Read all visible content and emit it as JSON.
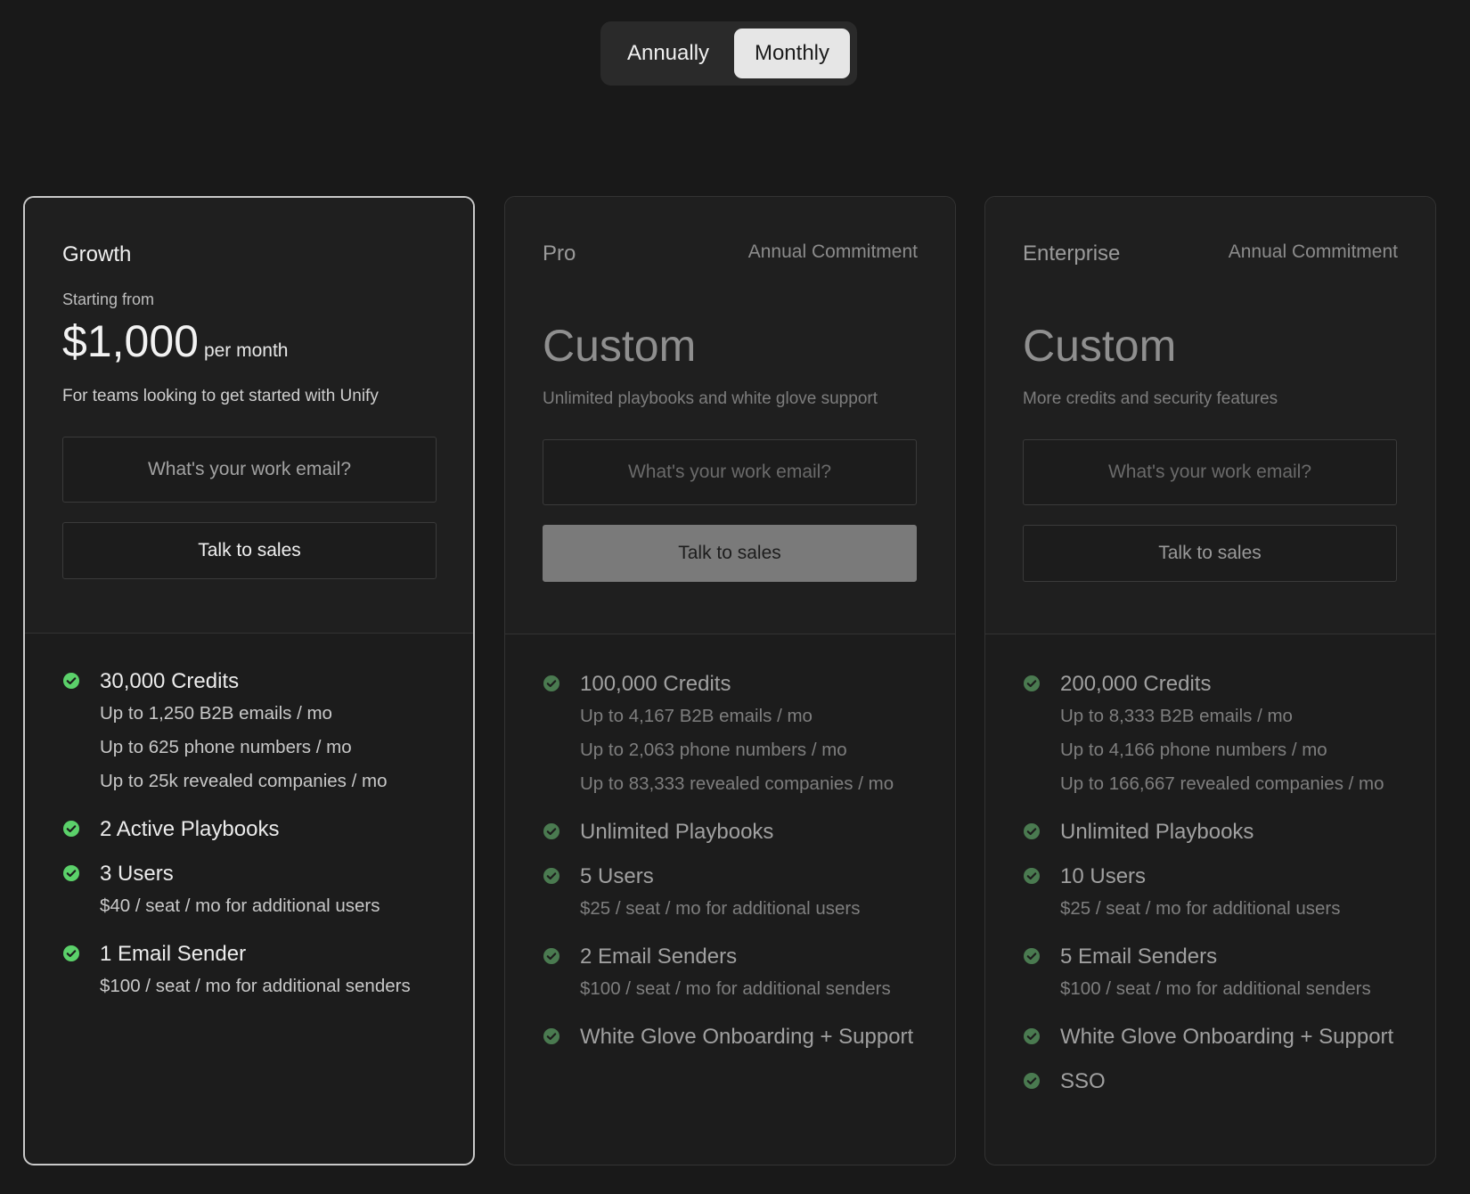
{
  "billing_toggle": {
    "annually_label": "Annually",
    "monthly_label": "Monthly",
    "selected": "Monthly"
  },
  "colors": {
    "check_active": "#5bd16a",
    "check_dim": "#4a7a50"
  },
  "plans": [
    {
      "name": "Growth",
      "starting_from": "Starting from",
      "price": "$1,000",
      "price_unit": "per month",
      "tagline": "For teams looking to get started with Unify",
      "email_placeholder": "What's your work email?",
      "cta_label": "Talk to sales",
      "features": [
        {
          "title": "30,000 Credits",
          "subs": [
            "Up to 1,250 B2B emails / mo",
            "Up to 625 phone numbers / mo",
            "Up to 25k revealed companies / mo"
          ]
        },
        {
          "title": "2 Active Playbooks",
          "subs": []
        },
        {
          "title": "3 Users",
          "subs": [
            "$40 / seat / mo for additional users"
          ]
        },
        {
          "title": "1 Email Sender",
          "subs": [
            "$100 / seat / mo for additional senders"
          ]
        }
      ]
    },
    {
      "name": "Pro",
      "commitment": "Annual Commitment",
      "price": "Custom",
      "tagline": "Unlimited playbooks and white glove support",
      "email_placeholder": "What's your work email?",
      "cta_label": "Talk to sales",
      "features": [
        {
          "title": "100,000 Credits",
          "subs": [
            "Up to 4,167 B2B emails / mo",
            "Up to 2,063 phone numbers / mo",
            "Up to 83,333 revealed companies / mo"
          ]
        },
        {
          "title": "Unlimited Playbooks",
          "subs": []
        },
        {
          "title": "5 Users",
          "subs": [
            "$25 / seat / mo for additional users"
          ]
        },
        {
          "title": "2 Email Senders",
          "subs": [
            "$100 / seat / mo for additional senders"
          ]
        },
        {
          "title": "White Glove Onboarding + Support",
          "subs": []
        }
      ]
    },
    {
      "name": "Enterprise",
      "commitment": "Annual Commitment",
      "price": "Custom",
      "tagline": "More credits and security features",
      "email_placeholder": "What's your work email?",
      "cta_label": "Talk to sales",
      "features": [
        {
          "title": "200,000 Credits",
          "subs": [
            "Up to 8,333 B2B emails / mo",
            "Up to 4,166 phone numbers / mo",
            "Up to 166,667 revealed companies / mo"
          ]
        },
        {
          "title": "Unlimited Playbooks",
          "subs": []
        },
        {
          "title": "10 Users",
          "subs": [
            "$25 / seat / mo for additional users"
          ]
        },
        {
          "title": "5 Email Senders",
          "subs": [
            "$100 / seat / mo for additional senders"
          ]
        },
        {
          "title": "White Glove Onboarding + Support",
          "subs": []
        },
        {
          "title": "SSO",
          "subs": []
        }
      ]
    }
  ]
}
